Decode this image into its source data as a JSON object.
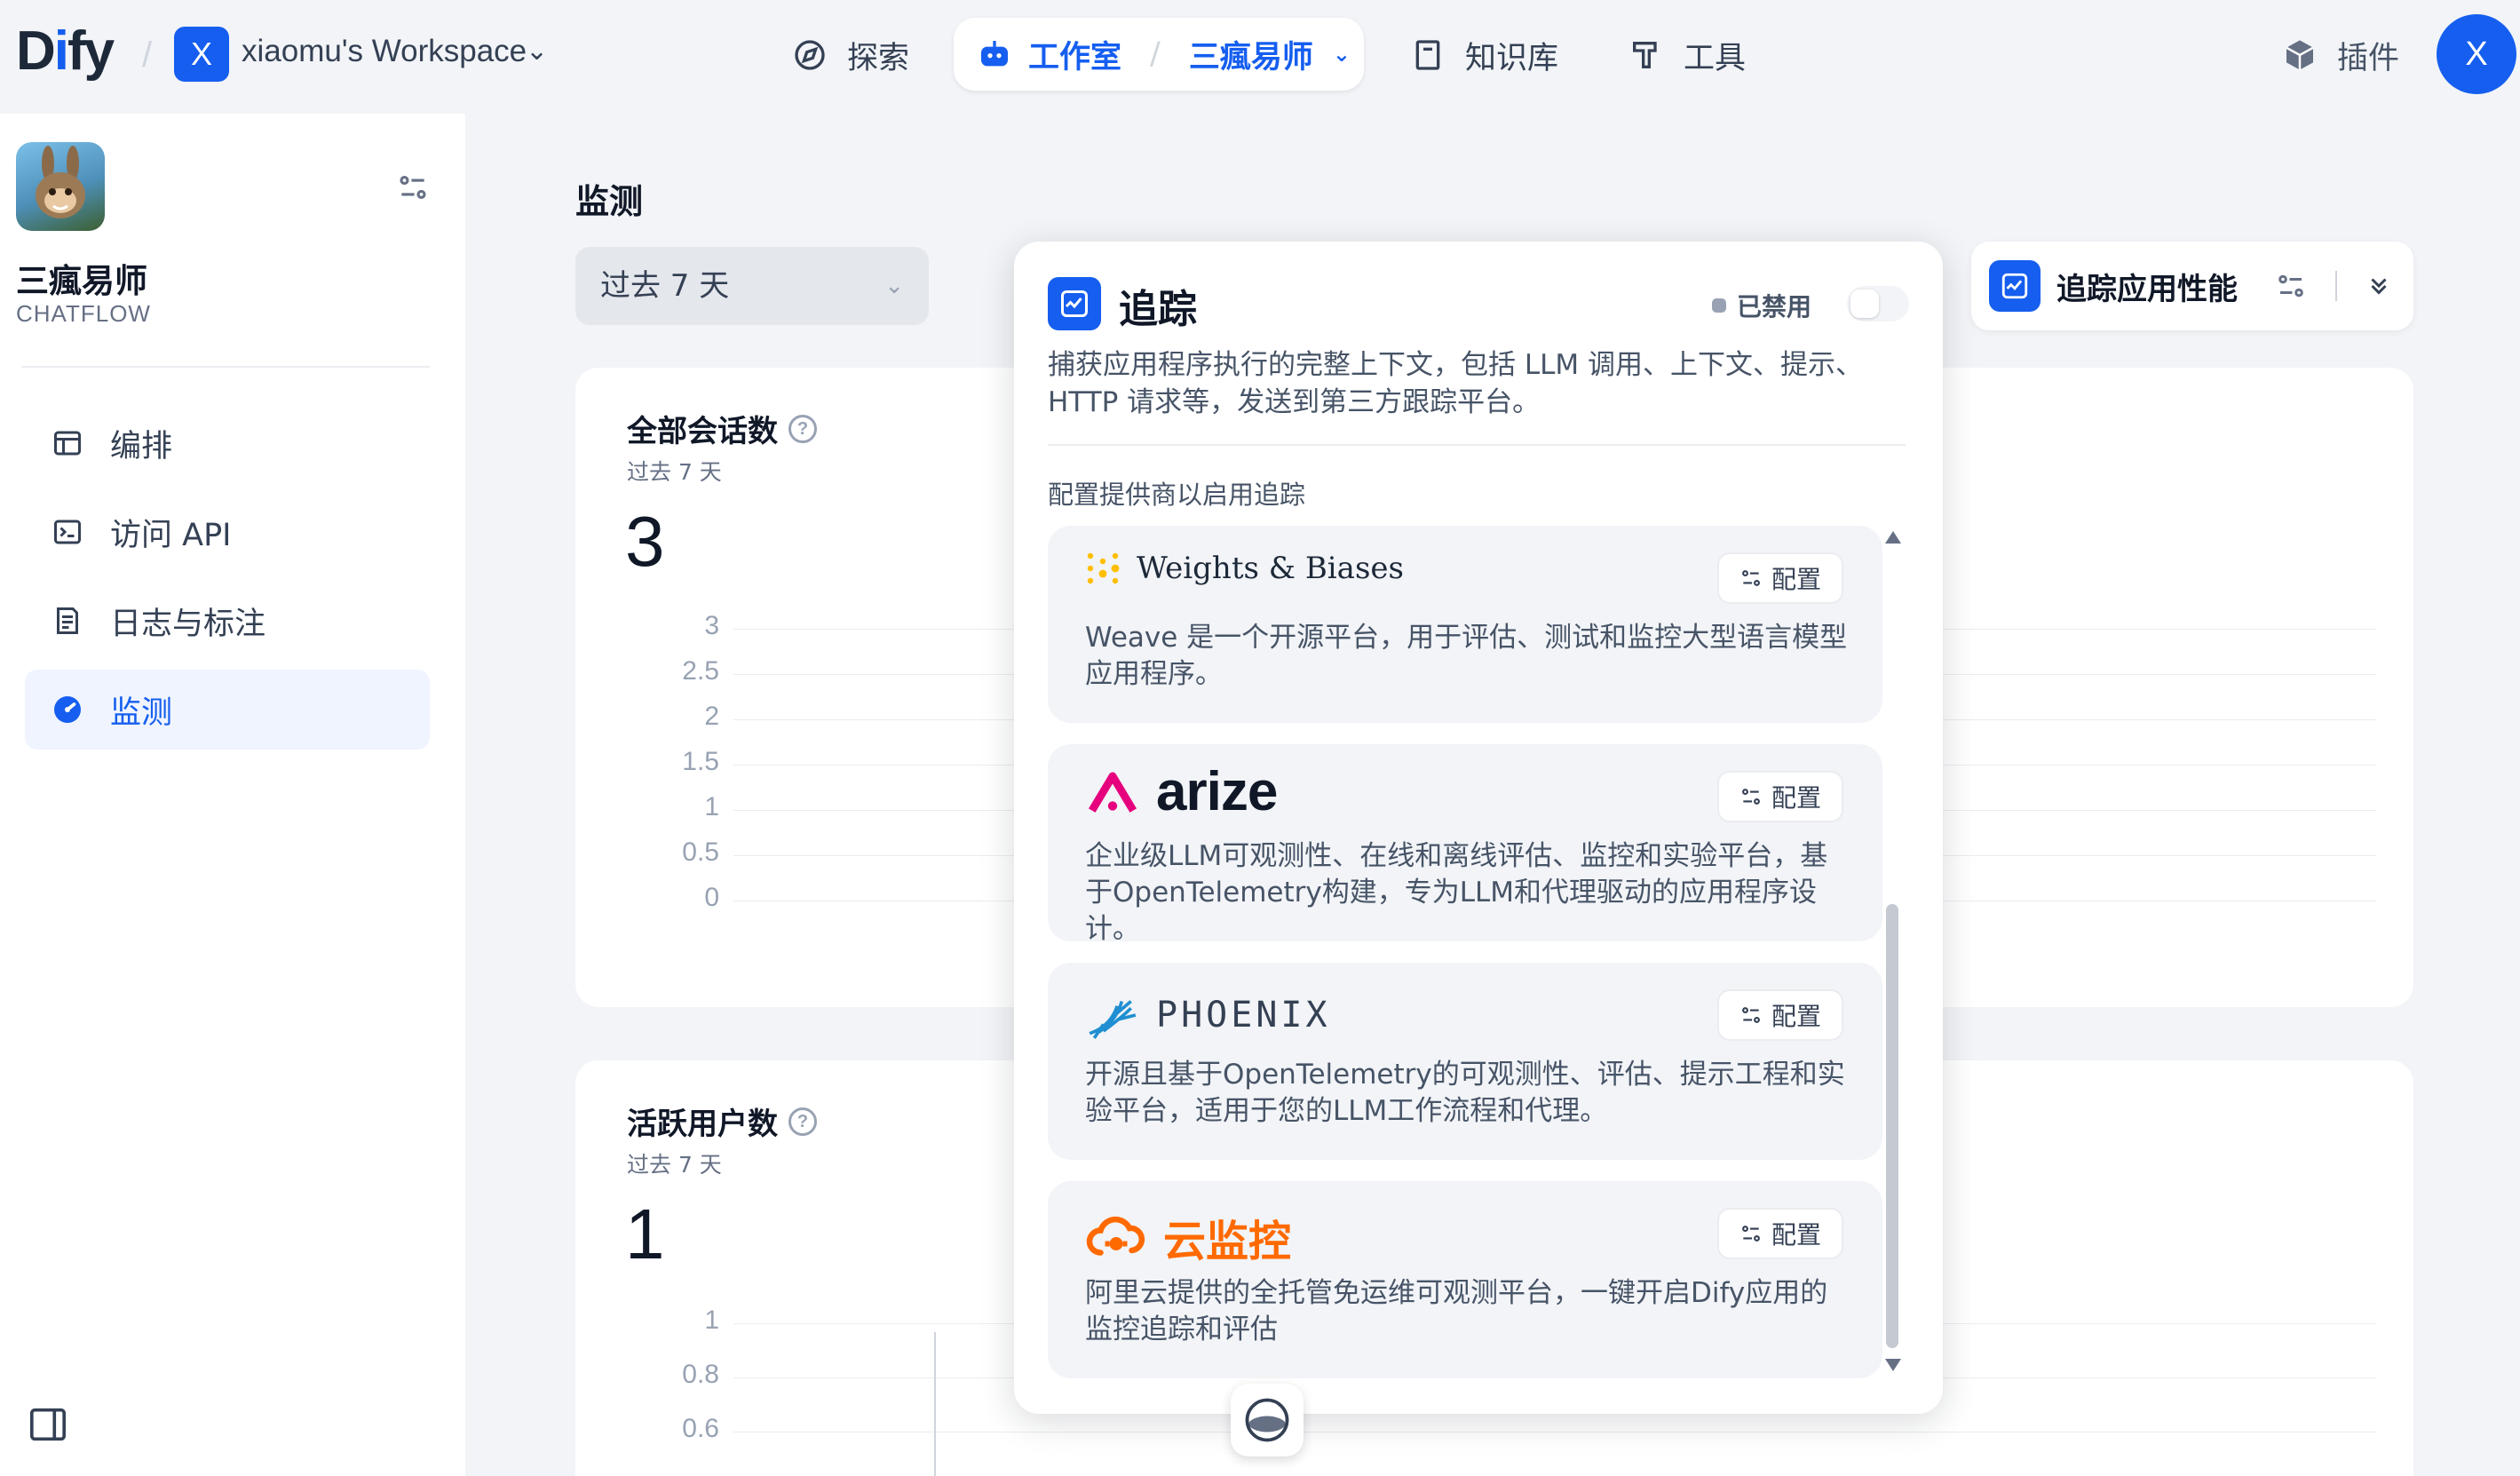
{
  "topbar": {
    "logo": "Dify",
    "workspace_initial": "X",
    "workspace_name": "xiaomu's Workspace",
    "nav": {
      "explore": "探索",
      "studio": "工作室",
      "current_app": "三瘋易师",
      "knowledge": "知识库",
      "tools": "工具",
      "plugins": "插件"
    },
    "user_initial": "X"
  },
  "sidebar": {
    "app_name": "三瘋易师",
    "app_type": "CHATFLOW",
    "items": [
      {
        "label": "编排",
        "icon": "layout-icon"
      },
      {
        "label": "访问 API",
        "icon": "terminal-icon"
      },
      {
        "label": "日志与标注",
        "icon": "file-list-icon"
      },
      {
        "label": "监测",
        "icon": "dashboard-icon",
        "active": true
      }
    ]
  },
  "main": {
    "title": "监测",
    "period": "过去 7 天",
    "cards": [
      {
        "title": "全部会话数",
        "subtitle": "过去 7 天",
        "value": "3",
        "ticks": [
          "3",
          "2.5",
          "2",
          "1.5",
          "1",
          "0.5",
          "0"
        ]
      },
      {
        "title": "活跃用户数",
        "subtitle": "过去 7 天",
        "value": "1",
        "ticks": [
          "1",
          "0.8",
          "0.6"
        ]
      }
    ]
  },
  "tracking_widget": {
    "label": "追踪应用性能"
  },
  "popup": {
    "title": "追踪",
    "status": "已禁用",
    "enabled": false,
    "description": "捕获应用程序执行的完整上下文，包括 LLM 调用、上下文、提示、HTTP 请求等，发送到第三方跟踪平台。",
    "section_label": "配置提供商以启用追踪",
    "config_label": "配置",
    "providers": [
      {
        "name": "Weights & Biases",
        "description": "Weave 是一个开源平台，用于评估、测试和监控大型语言模型应用程序。"
      },
      {
        "name": "arize",
        "description": "企业级LLM可观测性、在线和离线评估、监控和实验平台，基于OpenTelemetry构建，专为LLM和代理驱动的应用程序设计。"
      },
      {
        "name": "PHOENIX",
        "description": "开源且基于OpenTelemetry的可观测性、评估、提示工程和实验平台，适用于您的LLM工作流程和代理。"
      },
      {
        "name": "云监控",
        "description": "阿里云提供的全托管免运维可观测平台，一键开启Dify应用的监控追踪和评估"
      }
    ]
  },
  "colors": {
    "primary": "#155eef",
    "arize": "#e6007e",
    "aliyun": "#ff6a00",
    "wandb": "#ffbe00"
  }
}
